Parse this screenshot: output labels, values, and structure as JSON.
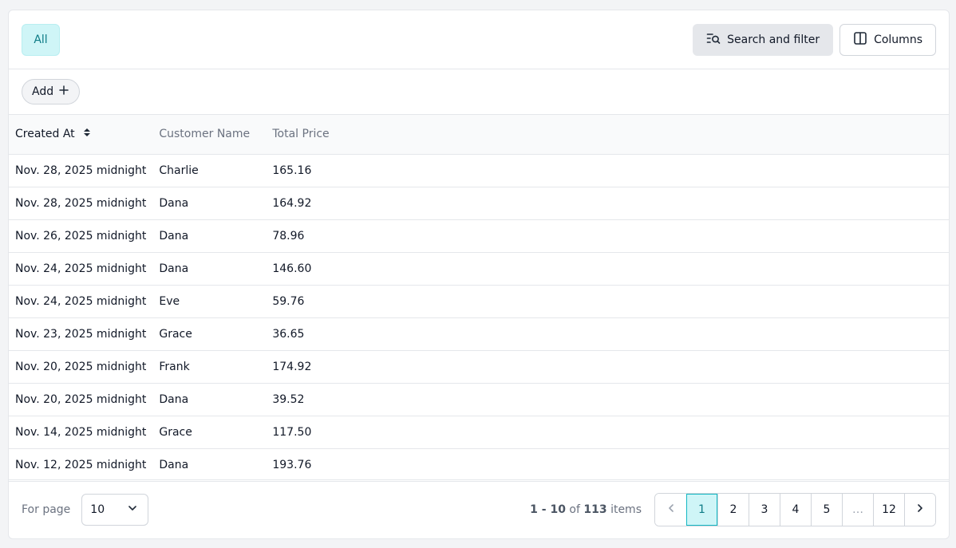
{
  "toolbar": {
    "tab_all": "All",
    "search_filter_label": "Search and filter",
    "columns_label": "Columns",
    "add_label": "Add"
  },
  "table": {
    "headers": [
      "Created At",
      "Customer Name",
      "Total Price"
    ],
    "rows": [
      [
        "Nov. 28, 2025 midnight",
        "Charlie",
        "165.16"
      ],
      [
        "Nov. 28, 2025 midnight",
        "Dana",
        "164.92"
      ],
      [
        "Nov. 26, 2025 midnight",
        "Dana",
        "78.96"
      ],
      [
        "Nov. 24, 2025 midnight",
        "Dana",
        "146.60"
      ],
      [
        "Nov. 24, 2025 midnight",
        "Eve",
        "59.76"
      ],
      [
        "Nov. 23, 2025 midnight",
        "Grace",
        "36.65"
      ],
      [
        "Nov. 20, 2025 midnight",
        "Frank",
        "174.92"
      ],
      [
        "Nov. 20, 2025 midnight",
        "Dana",
        "39.52"
      ],
      [
        "Nov. 14, 2025 midnight",
        "Grace",
        "117.50"
      ],
      [
        "Nov. 12, 2025 midnight",
        "Dana",
        "193.76"
      ]
    ]
  },
  "footer": {
    "per_page_label": "For page",
    "per_page_value": "10",
    "range": "1 - 10",
    "of_label": "of",
    "total": "113",
    "items_label": "items",
    "pages": [
      "1",
      "2",
      "3",
      "4",
      "5",
      "…",
      "12"
    ],
    "current_page": "1"
  },
  "icons": {
    "filter": "search-filter-icon",
    "columns": "columns-icon",
    "add": "plus-icon",
    "sort": "sort-icon",
    "prev": "chevron-left-icon",
    "next": "chevron-right-icon",
    "select": "chevron-down-icon"
  },
  "colors": {
    "accent": "#0e7c86",
    "accent_bg": "#cff5f7"
  }
}
